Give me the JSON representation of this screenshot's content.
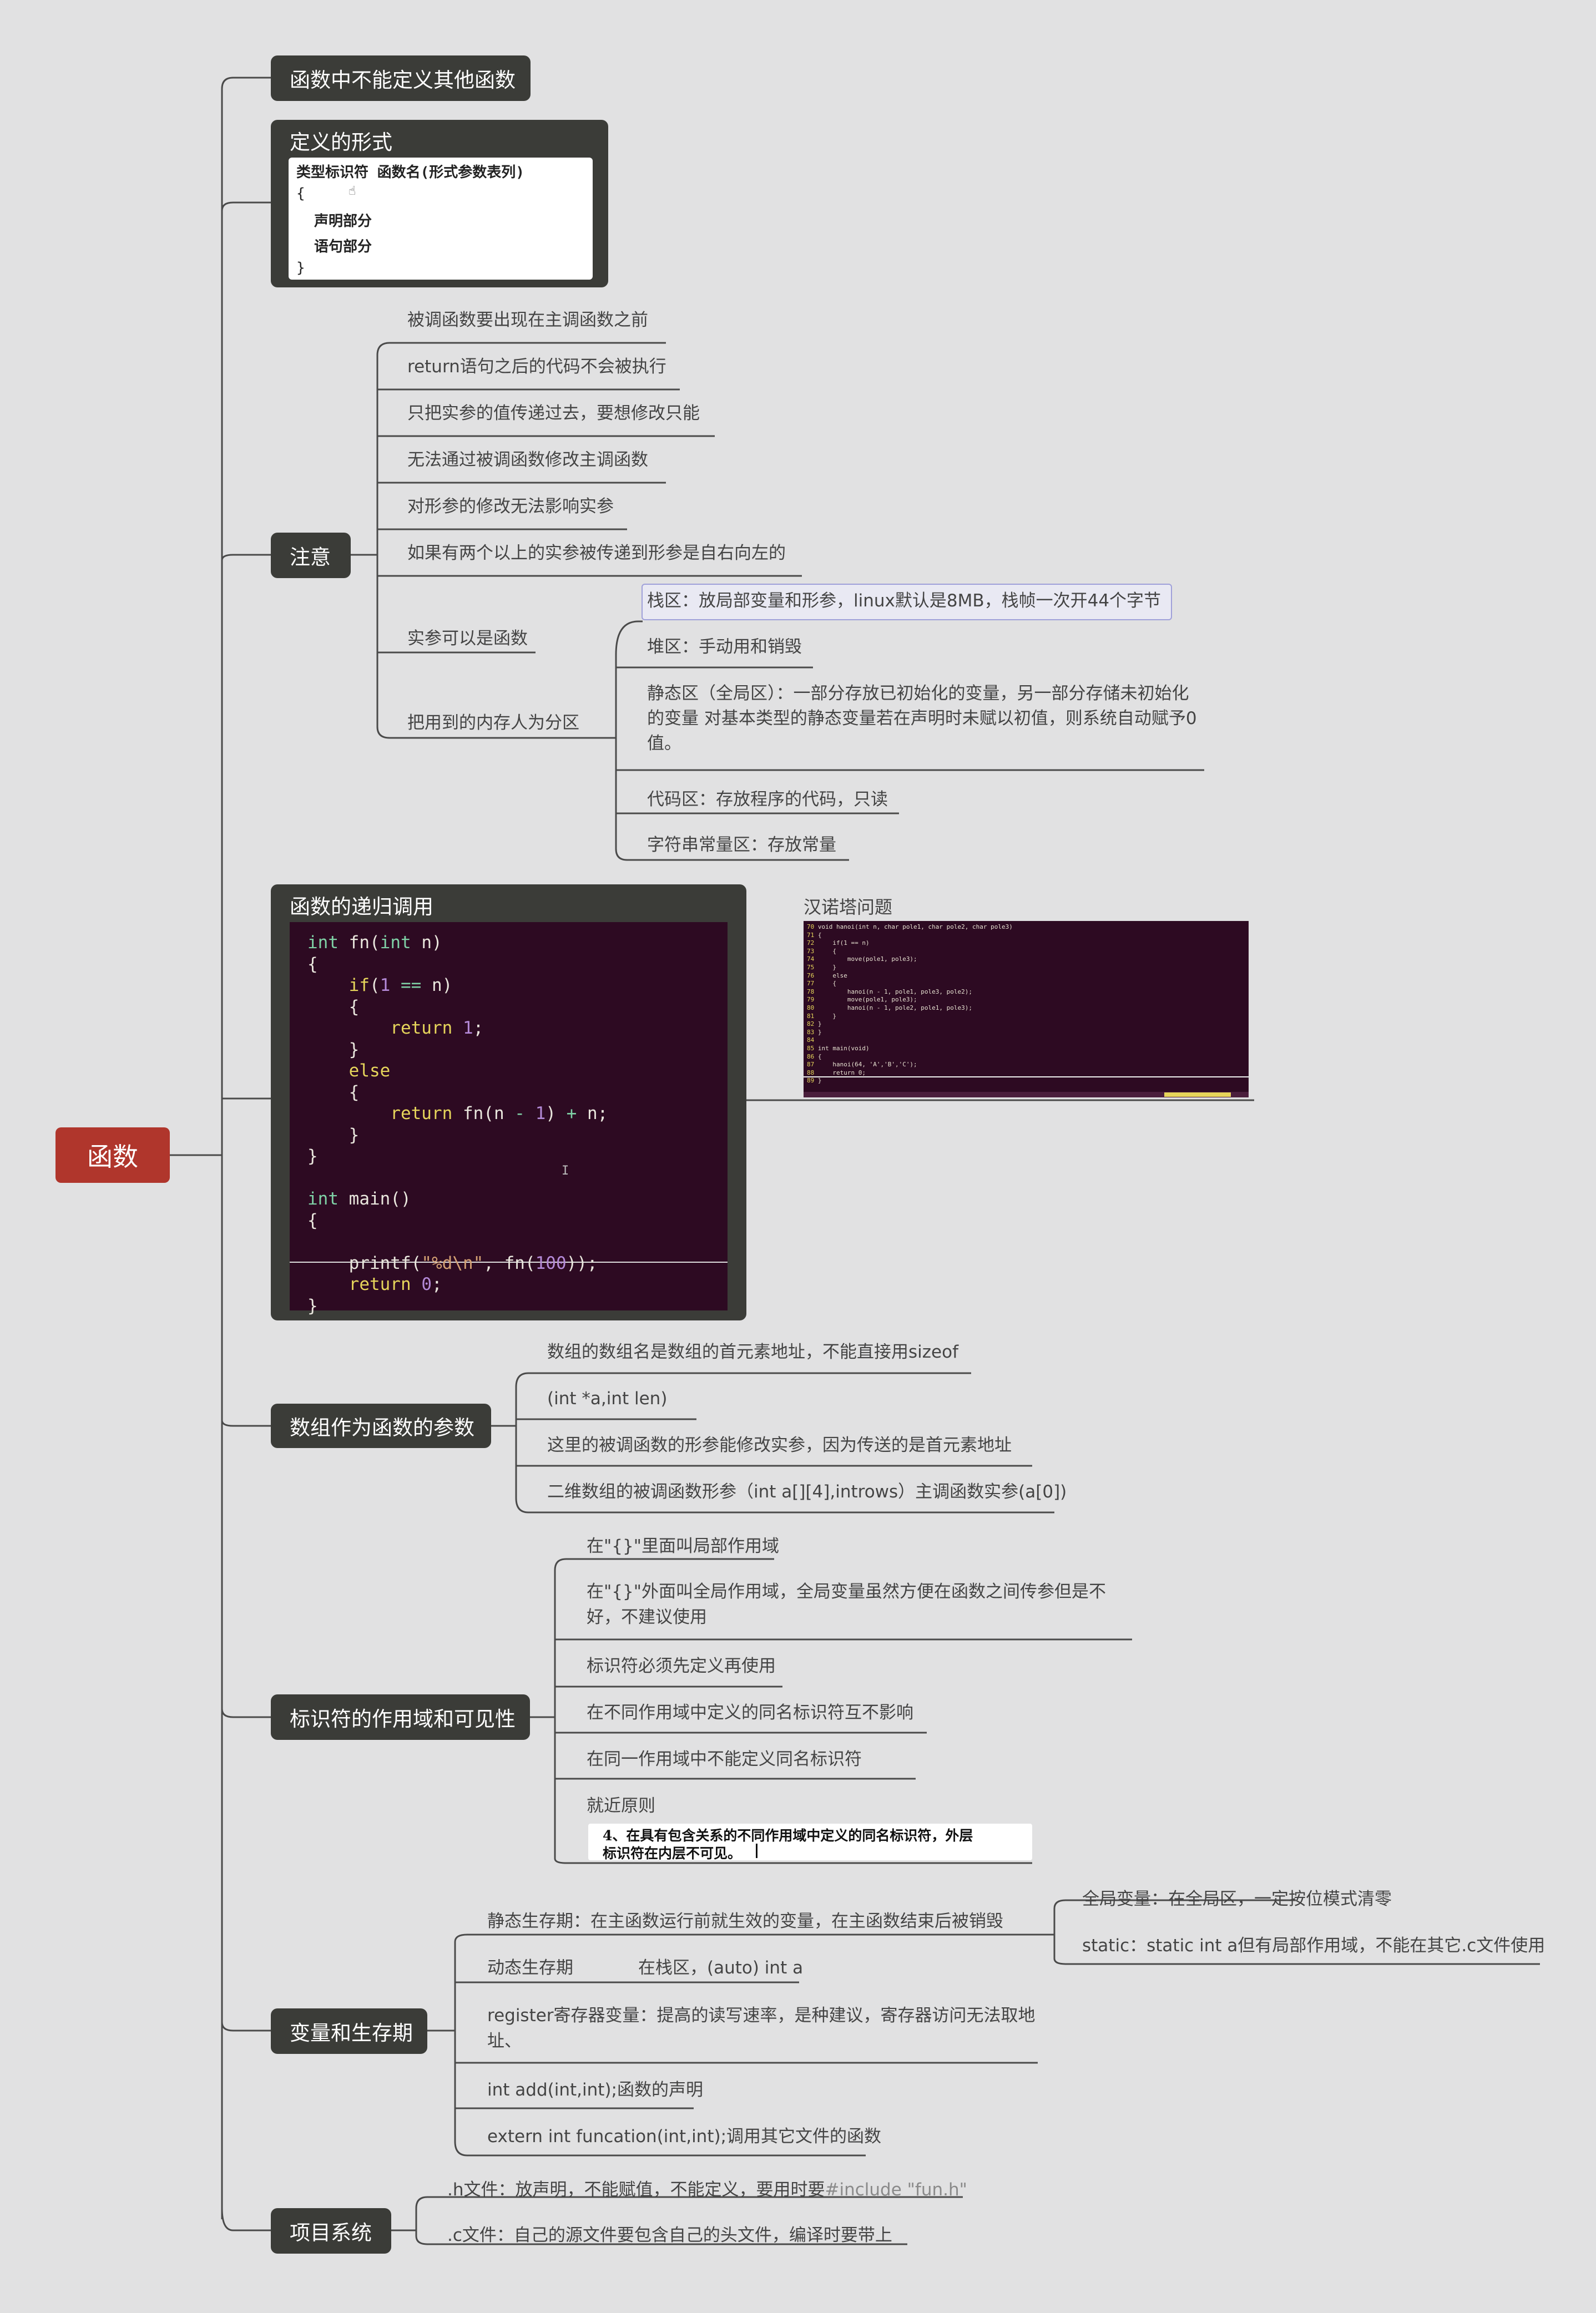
{
  "colors": {
    "background": "#e1e1e2",
    "root": "#b0362c",
    "node": "#3b3c38",
    "line": "#4a4a4a",
    "code_bg": "#2d0a22"
  },
  "root": {
    "label": "函数"
  },
  "branches": {
    "no_nested": {
      "label": "函数中不能定义其他函数"
    },
    "definition": {
      "label": "定义的形式",
      "card_lines": [
        "类型标识符 函数名(形式参数表列)",
        "{",
        "声明部分",
        "语句部分",
        "}"
      ]
    },
    "notes": {
      "label": "注意",
      "items": [
        "被调函数要出现在主调函数之前",
        "return语句之后的代码不会被执行",
        "只把实参的值传递过去，要想修改只能",
        "无法通过被调函数修改主调函数",
        "对形参的修改无法影响实参",
        "如果有两个以上的实参被传递到形参是自右向左的",
        "实参可以是函数",
        "把用到的内存人为分区"
      ],
      "memory_areas": [
        "栈区：放局部变量和形参，linux默认是8MB，栈帧一次开44个字节",
        "堆区：手动用和销毁",
        "静态区（全局区）：一部分存放已初始化的变量，另一部分存储未初始化的变量 对基本类型的静态变量若在声明时未赋以初值，则系统自动赋予0值。",
        "代码区：存放程序的代码，只读",
        "字符串常量区：存放常量"
      ]
    },
    "recursion": {
      "label": "函数的递归调用",
      "code": [
        {
          "seg": [
            [
              "kw",
              "int"
            ],
            [
              "p",
              " fn("
            ],
            [
              "kw",
              "int"
            ],
            [
              "p",
              " n)"
            ]
          ]
        },
        {
          "seg": [
            [
              "p",
              "{"
            ]
          ]
        },
        {
          "seg": [
            [
              "p",
              "    "
            ],
            [
              "ctl",
              "if"
            ],
            [
              "p",
              "("
            ],
            [
              "num",
              "1"
            ],
            [
              "p",
              " "
            ],
            [
              "kw",
              "=="
            ],
            [
              "p",
              " n)"
            ]
          ]
        },
        {
          "seg": [
            [
              "p",
              "    {"
            ]
          ]
        },
        {
          "seg": [
            [
              "p",
              "        "
            ],
            [
              "ctl",
              "return"
            ],
            [
              "p",
              " "
            ],
            [
              "num",
              "1"
            ],
            [
              "p",
              ";"
            ]
          ]
        },
        {
          "seg": [
            [
              "p",
              "    }"
            ]
          ]
        },
        {
          "seg": [
            [
              "p",
              "    "
            ],
            [
              "ctl",
              "else"
            ]
          ]
        },
        {
          "seg": [
            [
              "p",
              "    {"
            ]
          ]
        },
        {
          "seg": [
            [
              "p",
              "        "
            ],
            [
              "ctl",
              "return"
            ],
            [
              "p",
              " fn(n "
            ],
            [
              "kw",
              "-"
            ],
            [
              "p",
              " "
            ],
            [
              "num",
              "1"
            ],
            [
              "p",
              ") "
            ],
            [
              "kw",
              "+"
            ],
            [
              "p",
              " n;"
            ]
          ]
        },
        {
          "seg": [
            [
              "p",
              "    }"
            ]
          ]
        },
        {
          "seg": [
            [
              "p",
              "}"
            ]
          ]
        },
        {
          "seg": [
            [
              "p",
              ""
            ]
          ]
        },
        {
          "seg": [
            [
              "kw",
              "int"
            ],
            [
              "p",
              " main()"
            ]
          ]
        },
        {
          "seg": [
            [
              "p",
              "{"
            ]
          ]
        },
        {
          "seg": [
            [
              "p",
              ""
            ]
          ]
        },
        {
          "seg": [
            [
              "p",
              "    printf("
            ],
            [
              "str",
              "\"%d\\n\""
            ],
            [
              "p",
              ", fn("
            ],
            [
              "num",
              "100"
            ],
            [
              "p",
              "));"
            ]
          ]
        },
        {
          "seg": [
            [
              "p",
              "    "
            ],
            [
              "ctl",
              "return"
            ],
            [
              "p",
              " "
            ],
            [
              "num",
              "0"
            ],
            [
              "p",
              ";"
            ]
          ]
        },
        {
          "seg": [
            [
              "p",
              "}"
            ]
          ]
        }
      ],
      "hanoi_caption": "汉诺塔问题",
      "hanoi_lines": [
        "70 void hanoi(int n, char pole1, char pole2, char pole3)",
        "71 {",
        "72     if(1 == n)",
        "73     {",
        "74         move(pole1, pole3);",
        "75     }",
        "76     else",
        "77     {",
        "78         hanoi(n - 1, pole1, pole3, pole2);",
        "79         move(pole1, pole3);",
        "80         hanoi(n - 1, pole2, pole1, pole3);",
        "81     }",
        "82 }",
        "83 }",
        "84",
        "85 int main(void)",
        "86 {",
        "87     hanoi(64, 'A','B','C');",
        "88     return 0;",
        "89 }"
      ]
    },
    "array_params": {
      "label": "数组作为函数的参数",
      "items": [
        "数组的数组名是数组的首元素地址，不能直接用sizeof",
        "(int *a,int len)",
        "这里的被调函数的形参能修改实参，因为传送的是首元素地址",
        "二维数组的被调函数形参（int a[][4],introws）主调函数实参(a[0])"
      ]
    },
    "scope": {
      "label": "标识符的作用域和可见性",
      "items": [
        "在\"{}\"里面叫局部作用域",
        "在\"{}\"外面叫全局作用域，全局变量虽然方便在函数之间传参但是不好，不建议使用",
        "标识符必须先定义再使用",
        "在不同作用域中定义的同名标识符互不影响",
        "在同一作用域中不能定义同名标识符",
        "就近原则"
      ],
      "quote_lines": [
        "4、在具有包含关系的不同作用域中定义的同名标识符，外层",
        "标识符在内层不可见。"
      ]
    },
    "lifetime": {
      "label": "变量和生存期",
      "items": [
        "静态生存期：在主函数运行前就生效的变量，在主函数结束后被销毁",
        "动态生存期",
        "在栈区，(auto) int a",
        "register寄存器变量：提高的读写速率，是种建议，寄存器访问无法取地址、",
        "int add(int,int);函数的声明",
        "extern int funcation(int,int);调用其它文件的函数"
      ],
      "static_sub": [
        "全局变量：在全局区，一定按位模式清零",
        "static：static int a但有局部作用域，不能在其它.c文件使用"
      ]
    },
    "project": {
      "label": "项目系统",
      "items_h": [
        ".h文件：放声明，不能赋值，不能定义，要用时要",
        "#include \"fun.h\""
      ],
      "item_c": ".c文件：自己的源文件要包含自己的头文件，编译时要带上"
    }
  }
}
